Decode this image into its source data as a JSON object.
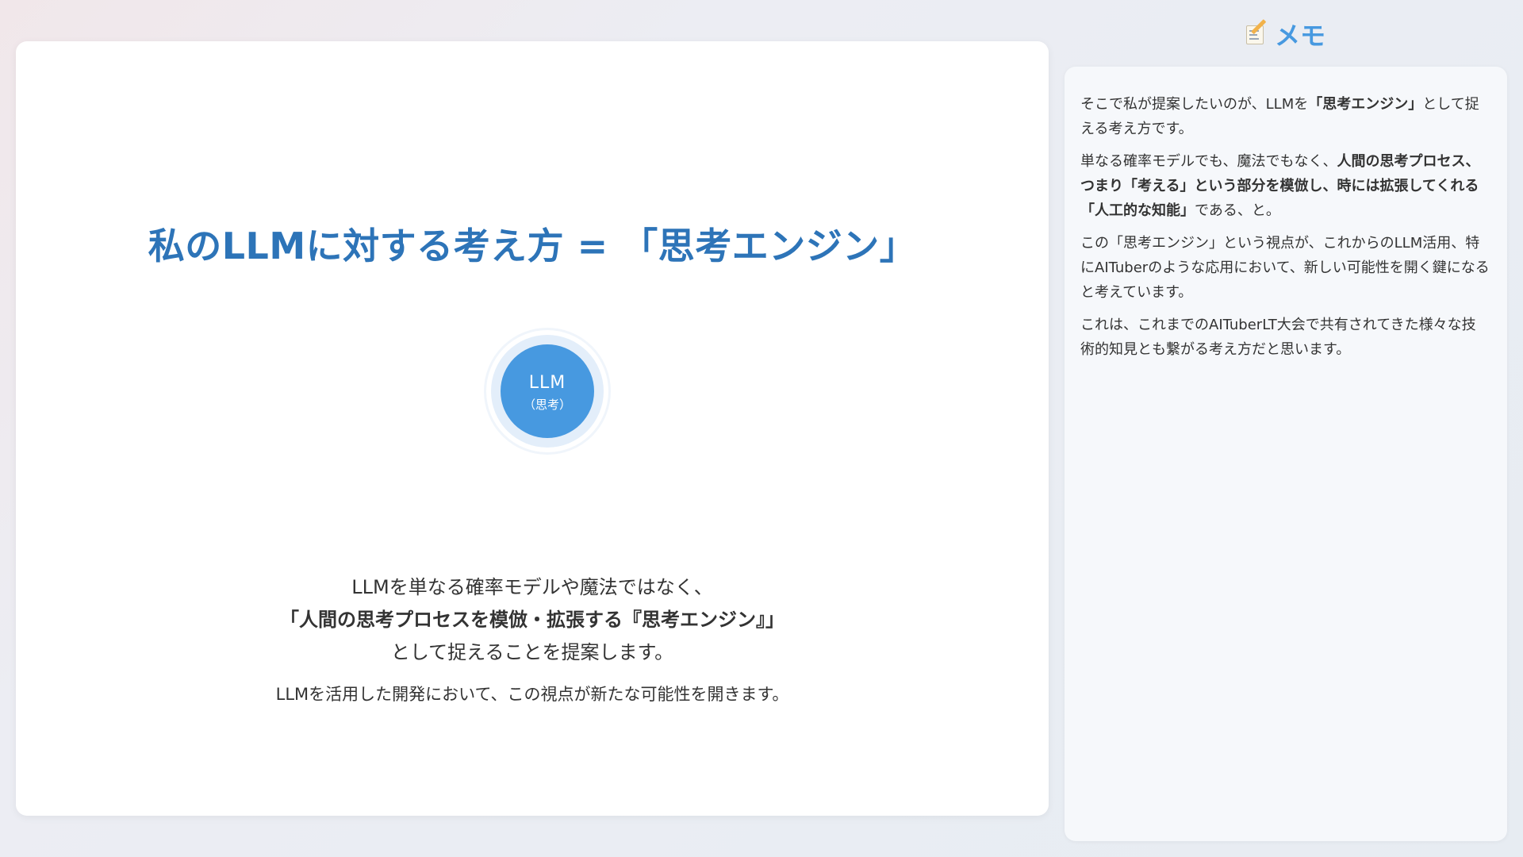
{
  "slide": {
    "title": "私のLLMに対する考え方 = 「思考エンジン」",
    "circle": {
      "label": "LLM",
      "sublabel": "（思考）"
    },
    "description": {
      "line1": "LLMを単なる確率モデルや魔法ではなく、",
      "line2_bold": "「人間の思考プロセスを模倣・拡張する『思考エンジン』」",
      "line3": "として捉えることを提案します。"
    },
    "subtext": "LLMを活用した開発において、この視点が新たな可能性を開きます。"
  },
  "memo": {
    "icon": "memo-pencil-icon",
    "title": "メモ",
    "p1": {
      "pre": "そこで私が提案したいのが、LLMを",
      "bold": "「思考エンジン」",
      "post": "として捉える考え方です。"
    },
    "p2": {
      "pre": "単なる確率モデルでも、魔法でもなく、",
      "bold": "人間の思考プロセス、つまり「考える」という部分を模倣し、時には拡張してくれる「人工的な知能」",
      "post": "である、と。"
    },
    "p3": "この「思考エンジン」という視点が、これからのLLM活用、特にAITuberのような応用において、新しい可能性を開く鍵になると考えています。",
    "p4": "これは、これまでのAITuberLT大会で共有されてきた様々な技術的知見とも繋がる考え方だと思います。"
  },
  "colors": {
    "accent": "#2d74b8",
    "circle": "#4799e0",
    "memo_title": "#4799e0"
  }
}
